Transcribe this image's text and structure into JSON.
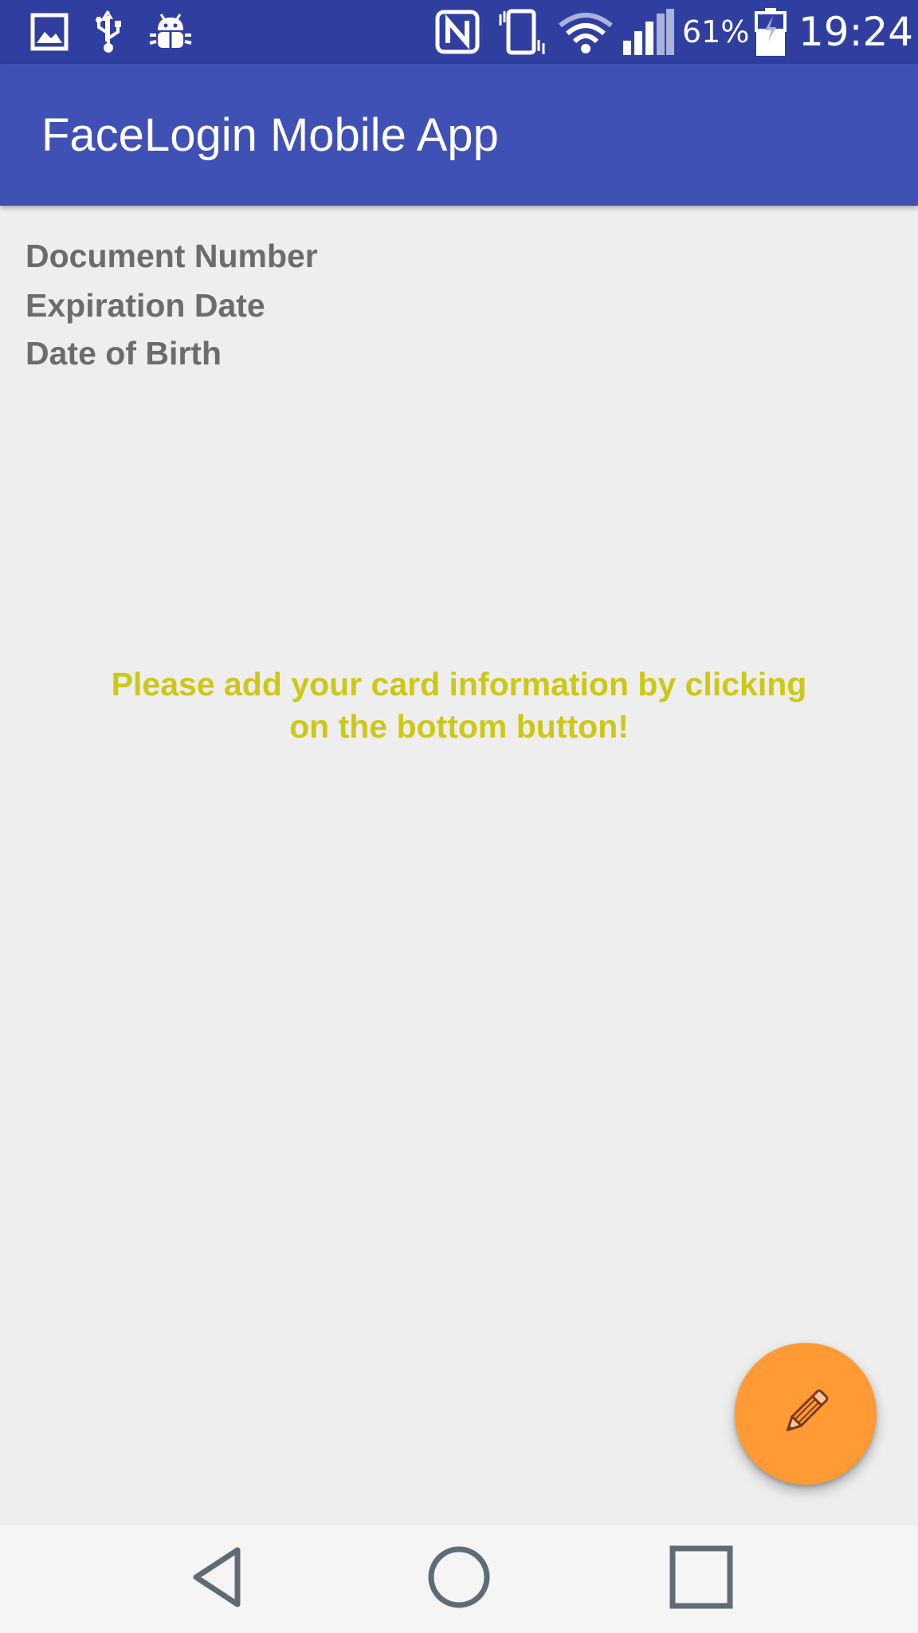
{
  "status_bar": {
    "icons": [
      "image-icon",
      "usb-icon",
      "android-debug-icon",
      "nfc-icon",
      "vibrate-icon",
      "wifi-icon",
      "signal-icon",
      "battery-charging-icon"
    ],
    "battery_percent": "61%",
    "time": "19:24"
  },
  "app_bar": {
    "title": "FaceLogin Mobile App"
  },
  "card_fields": {
    "document_number": "Document Number",
    "expiration_date": "Expiration Date",
    "date_of_birth": "Date of Birth"
  },
  "prompt": {
    "line1": "Please add your card information by clicking",
    "line2": "on the bottom button!"
  },
  "fab": {
    "icon": "pencil-icon"
  },
  "nav_bar": {
    "icons": [
      "back-icon",
      "home-icon",
      "recents-icon"
    ]
  },
  "colors": {
    "status_bar": "#303f9f",
    "app_bar": "#3f51b5",
    "background": "#eeeeee",
    "label_text": "#6c6c6c",
    "prompt_text": "#cdc816",
    "fab": "#ff9a35",
    "nav_bar": "#f5f5f5",
    "nav_icon": "#5f6b75"
  }
}
